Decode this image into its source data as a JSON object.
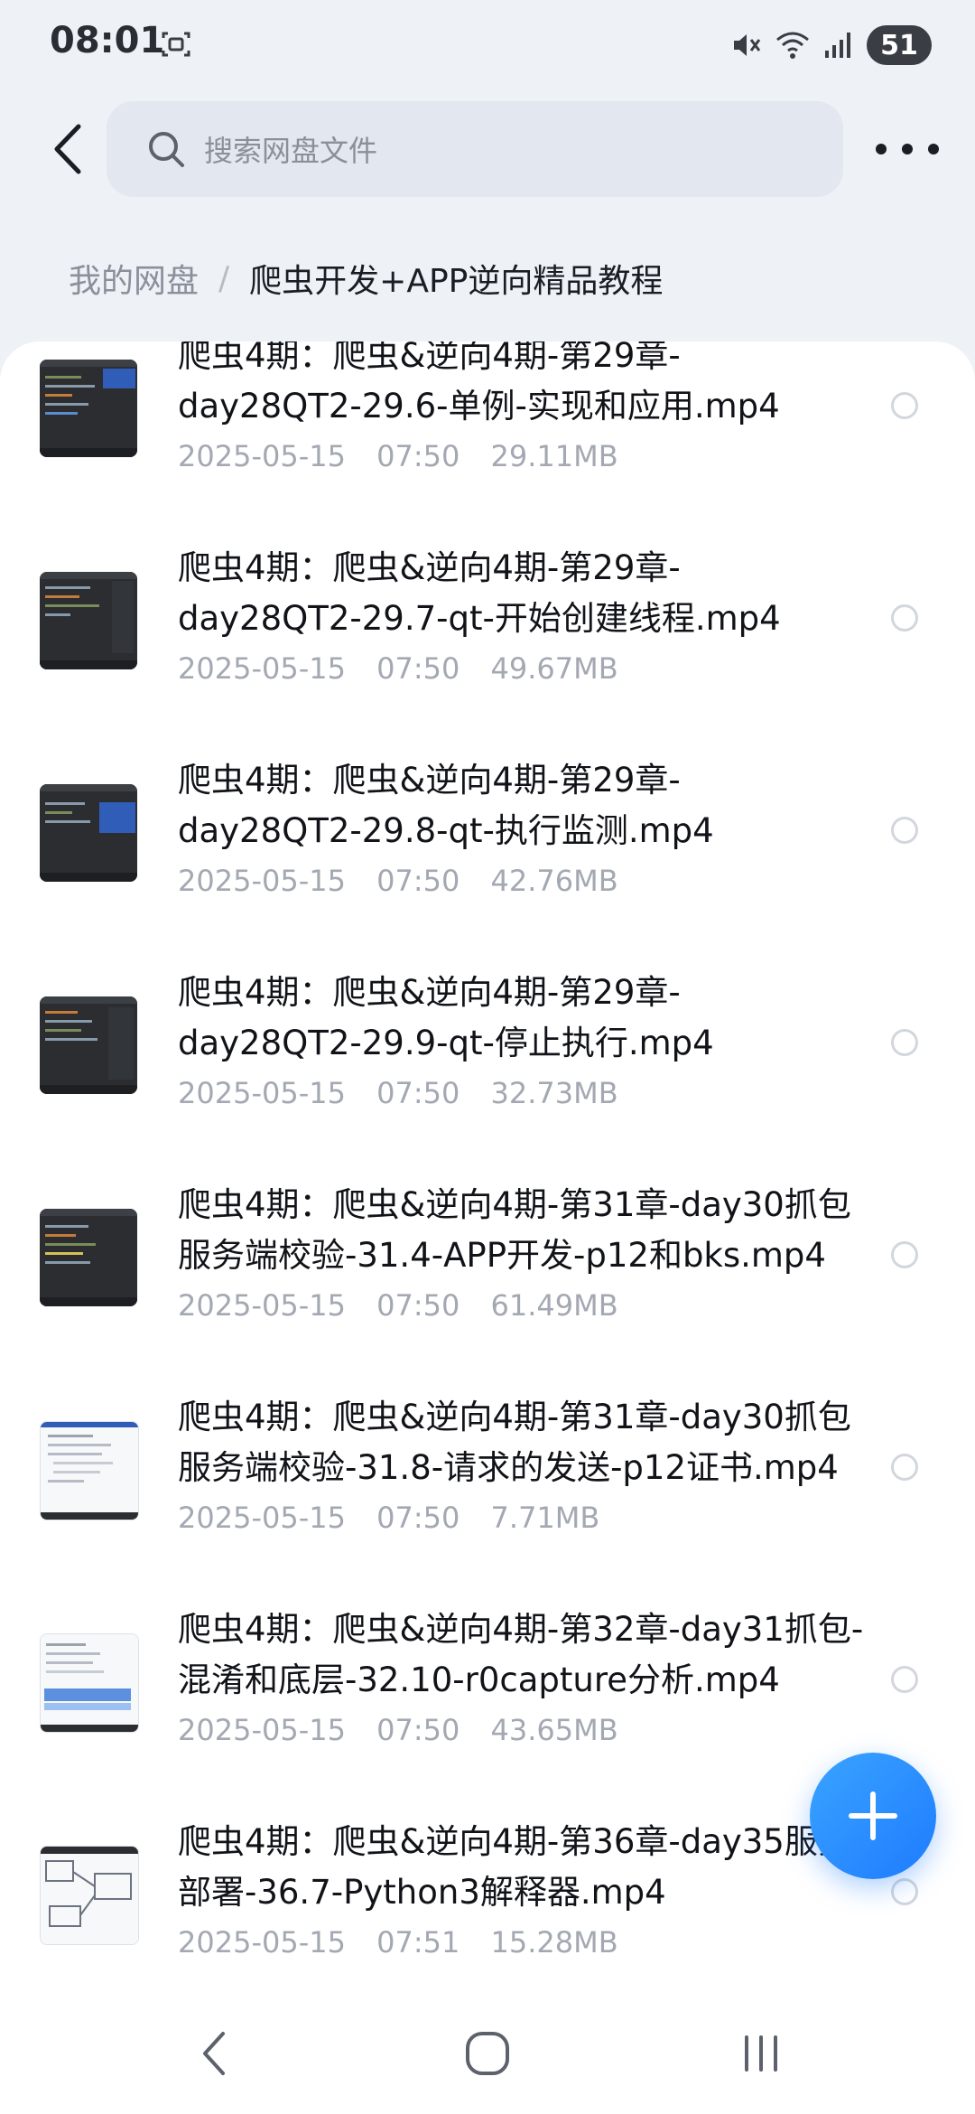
{
  "status_bar": {
    "time": "08:01",
    "battery": "51"
  },
  "search": {
    "placeholder": "搜索网盘文件"
  },
  "breadcrumb": {
    "root": "我的网盘",
    "separator": "/",
    "current": "爬虫开发+APP逆向精品教程"
  },
  "files": [
    {
      "name": "爬虫4期：爬虫&逆向4期-第29章-day28QT2-29.6-单例-实现和应用.mp4",
      "date": "2025-05-15",
      "time": "07:50",
      "size": "29.11MB",
      "thumb": "dark-code"
    },
    {
      "name": "爬虫4期：爬虫&逆向4期-第29章-day28QT2-29.7-qt-开始创建线程.mp4",
      "date": "2025-05-15",
      "time": "07:50",
      "size": "49.67MB",
      "thumb": "dark-code"
    },
    {
      "name": "爬虫4期：爬虫&逆向4期-第29章-day28QT2-29.8-qt-执行监测.mp4",
      "date": "2025-05-15",
      "time": "07:50",
      "size": "42.76MB",
      "thumb": "dark-code"
    },
    {
      "name": "爬虫4期：爬虫&逆向4期-第29章-day28QT2-29.9-qt-停止执行.mp4",
      "date": "2025-05-15",
      "time": "07:50",
      "size": "32.73MB",
      "thumb": "dark-code"
    },
    {
      "name": "爬虫4期：爬虫&逆向4期-第31章-day30抓包服务端校验-31.4-APP开发-p12和bks.mp4",
      "date": "2025-05-15",
      "time": "07:50",
      "size": "61.49MB",
      "thumb": "dark-code"
    },
    {
      "name": "爬虫4期：爬虫&逆向4期-第31章-day30抓包服务端校验-31.8-请求的发送-p12证书.mp4",
      "date": "2025-05-15",
      "time": "07:50",
      "size": "7.71MB",
      "thumb": "light-doc"
    },
    {
      "name": "爬虫4期：爬虫&逆向4期-第32章-day31抓包-混淆和底层-32.10-r0capture分析.mp4",
      "date": "2025-05-15",
      "time": "07:50",
      "size": "43.65MB",
      "thumb": "light-doc"
    },
    {
      "name": "爬虫4期：爬虫&逆向4期-第36章-day35服务部署-36.7-Python3解释器.mp4",
      "date": "2025-05-15",
      "time": "07:51",
      "size": "15.28MB",
      "thumb": "light-diagram"
    }
  ],
  "colors": {
    "accent": "#1e7bff",
    "meta_text": "#a3a8b2",
    "background": "#eef1f6"
  },
  "icons": {
    "fab": "plus-icon",
    "back": "chevron-left-icon",
    "search": "search-icon",
    "more": "more-dots-icon"
  }
}
